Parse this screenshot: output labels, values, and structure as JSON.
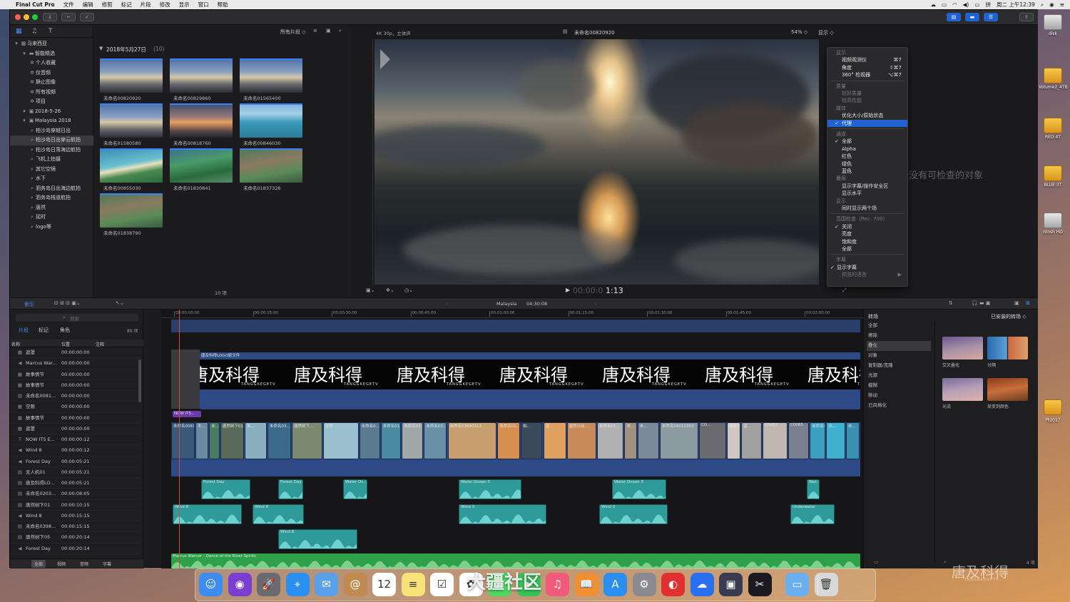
{
  "menubar": {
    "app": "Final Cut Pro",
    "items": [
      "文件",
      "编辑",
      "修剪",
      "标记",
      "片段",
      "修改",
      "显示",
      "窗口",
      "帮助"
    ],
    "clock": "周二 上午12:39"
  },
  "library": {
    "items": [
      {
        "label": "马来西亚",
        "indent": 0,
        "icon": "library-icon"
      },
      {
        "label": "智能精选",
        "indent": 1,
        "icon": "folder-icon"
      },
      {
        "label": "个人收藏",
        "indent": 2,
        "icon": "gear-icon"
      },
      {
        "label": "仅音频",
        "indent": 2,
        "icon": "gear-icon"
      },
      {
        "label": "静止图像",
        "indent": 2,
        "icon": "gear-icon"
      },
      {
        "label": "所有视频",
        "indent": 2,
        "icon": "gear-icon"
      },
      {
        "label": "项目",
        "indent": 2,
        "icon": "gear-icon"
      },
      {
        "label": "2018-5-26",
        "indent": 1,
        "icon": "event-icon"
      },
      {
        "label": "Malaysia 2018",
        "indent": 1,
        "icon": "event-icon"
      },
      {
        "label": "柏沙岛穿越日出",
        "indent": 2,
        "icon": "keyword-icon"
      },
      {
        "label": "柏沙岛日出穿云航拍",
        "indent": 2,
        "icon": "keyword-icon",
        "selected": true
      },
      {
        "label": "柏沙岛日落海边航拍",
        "indent": 2,
        "icon": "keyword-icon"
      },
      {
        "label": "飞机上拍摄",
        "indent": 2,
        "icon": "keyword-icon"
      },
      {
        "label": "其它空镜",
        "indent": 2,
        "icon": "keyword-icon"
      },
      {
        "label": "水下",
        "indent": 2,
        "icon": "keyword-icon"
      },
      {
        "label": "泗务岛日出海边航拍",
        "indent": 2,
        "icon": "keyword-icon"
      },
      {
        "label": "泗务岛栈道航拍",
        "indent": 2,
        "icon": "keyword-icon"
      },
      {
        "label": "唐然",
        "indent": 2,
        "icon": "keyword-icon"
      },
      {
        "label": "延时",
        "indent": 2,
        "icon": "keyword-icon"
      },
      {
        "label": "logo等",
        "indent": 2,
        "icon": "keyword-icon"
      }
    ]
  },
  "browser": {
    "filter": "所有片段 ◇",
    "group_title": "2018年5月27日",
    "group_count": "(10)",
    "count_label": "10 项",
    "clips": [
      {
        "name": "未命名00820920",
        "tone": "sky"
      },
      {
        "name": "未命名00829860",
        "tone": "sky"
      },
      {
        "name": "未命名01565400",
        "tone": "sky"
      },
      {
        "name": "未命名01580580",
        "tone": "sky"
      },
      {
        "name": "未命名00818760",
        "tone": "sunset"
      },
      {
        "name": "未命名00846030",
        "tone": "sea"
      },
      {
        "name": "未命名00855030",
        "tone": "beach"
      },
      {
        "name": "未命名01830841",
        "tone": "island"
      },
      {
        "name": "未命名01837326",
        "tone": "village"
      },
      {
        "name": "未命名01838790",
        "tone": "village"
      }
    ]
  },
  "viewer": {
    "format": "4K 30p，立体声",
    "clip_name": "未命名00820920",
    "zoom": "54% ◇",
    "display": "显示 ◇",
    "timecode_dim": "00:00:0",
    "timecode": "1:13",
    "no_inspect": "没有可检查的对象"
  },
  "display_menu": {
    "rows": [
      {
        "type": "hdr",
        "label": "显示"
      },
      {
        "type": "item",
        "label": "视频观测仪",
        "shortcut": "⌘7"
      },
      {
        "type": "item",
        "label": "角度",
        "shortcut": "⇧⌘7"
      },
      {
        "type": "item",
        "label": "360° 检视器",
        "shortcut": "⌥⌘7"
      },
      {
        "type": "sep"
      },
      {
        "type": "hdr",
        "label": "质量"
      },
      {
        "type": "dis",
        "label": "较好质量"
      },
      {
        "type": "dis",
        "label": "较高性能"
      },
      {
        "type": "hdr",
        "label": "媒体"
      },
      {
        "type": "item",
        "label": "优化大小/原始状态"
      },
      {
        "type": "sel",
        "label": "代理",
        "check": "✓"
      },
      {
        "type": "sep"
      },
      {
        "type": "hdr",
        "label": "通道"
      },
      {
        "type": "item",
        "label": "全部",
        "check": "✓"
      },
      {
        "type": "item",
        "label": "Alpha"
      },
      {
        "type": "item",
        "label": "红色"
      },
      {
        "type": "item",
        "label": "绿色"
      },
      {
        "type": "item",
        "label": "蓝色"
      },
      {
        "type": "hdr",
        "label": "叠层"
      },
      {
        "type": "item",
        "label": "显示字幕/操作安全区"
      },
      {
        "type": "item",
        "label": "显示水平"
      },
      {
        "type": "hdr",
        "label": "显示"
      },
      {
        "type": "item",
        "label": "同时显示两个场"
      },
      {
        "type": "sep"
      },
      {
        "type": "hdr",
        "label": "范围检查（Rec. 709）"
      },
      {
        "type": "item",
        "label": "关闭",
        "check": "✓"
      },
      {
        "type": "item",
        "label": "亮度"
      },
      {
        "type": "item",
        "label": "饱和度"
      },
      {
        "type": "item",
        "label": "全部"
      },
      {
        "type": "sep"
      },
      {
        "type": "hdr",
        "label": "字幕"
      },
      {
        "type": "item",
        "label": "显示字幕",
        "check": "✓",
        "tight": true
      },
      {
        "type": "dis",
        "label": "预览的语言",
        "arrow": "▶"
      }
    ]
  },
  "midbar": {
    "index": "索引",
    "project": "Malaysia",
    "duration": "04:30:08"
  },
  "timeline_index": {
    "search_placeholder": "搜索",
    "tabs": [
      "片段",
      "标记",
      "角色"
    ],
    "count": "89 项",
    "columns": [
      "名称",
      "位置",
      "注释"
    ],
    "rows": [
      {
        "icon": "▦",
        "name": "遮罩",
        "time": "00:00:00:00"
      },
      {
        "icon": "◀",
        "name": "Marcus War...",
        "time": "00:00:00:00"
      },
      {
        "icon": "▦",
        "name": "故事情节",
        "time": "00:00:00:00"
      },
      {
        "icon": "▦",
        "name": "故事情节",
        "time": "00:00:00:00"
      },
      {
        "icon": "▤",
        "name": "未命名0081...",
        "time": "00:00:00:00"
      },
      {
        "icon": "▦",
        "name": "空隙",
        "time": "00:00:00:00"
      },
      {
        "icon": "▦",
        "name": "故事情节",
        "time": "00:00:00:00"
      },
      {
        "icon": "▦",
        "name": "遮罩",
        "time": "00:00:00:00"
      },
      {
        "icon": "T",
        "name": "NOW ITS E...",
        "time": "00:00:00:12"
      },
      {
        "icon": "◀",
        "name": "Wind 8",
        "time": "00:00:00:12"
      },
      {
        "icon": "◀",
        "name": "Forest Day",
        "time": "00:00:05:21"
      },
      {
        "icon": "▤",
        "name": "无人机01",
        "time": "00:00:05:21"
      },
      {
        "icon": "▤",
        "name": "唐及科得LO...",
        "time": "00:00:05:21"
      },
      {
        "icon": "▤",
        "name": "未命名0203...",
        "time": "00:00:08:05"
      },
      {
        "icon": "▤",
        "name": "唐然树下01",
        "time": "00:00:10:15"
      },
      {
        "icon": "◀",
        "name": "Wind 8",
        "time": "00:00:15:15"
      },
      {
        "icon": "▤",
        "name": "未命名0398...",
        "time": "00:00:15:15"
      },
      {
        "icon": "▤",
        "name": "唐然树下05",
        "time": "00:00:20:14"
      },
      {
        "icon": "◀",
        "name": "Forest Day",
        "time": "00:00:20:14"
      }
    ],
    "footer": [
      "全部",
      "视频",
      "音频",
      "字幕"
    ]
  },
  "timeline": {
    "ruler": [
      "00:00:00:00",
      "00:00:15:00",
      "00:00:30:00",
      "00:00:45:00",
      "00:01:00:00",
      "00:01:15:00",
      "00:01:30:00",
      "00:01:45:00",
      "00:02:00:00"
    ],
    "logo_clip": "唐及科得LOGO原文件",
    "logo_text": "唐及科得",
    "logo_sub": "TANG&KEGETV",
    "title_clip": "NOW ITS...",
    "primary_labels": [
      "未命名0081...",
      "木...",
      "未...",
      "唐然树下01",
      "未...",
      "未命名03...",
      "唐然树下...",
      "未命",
      "未命名0...",
      "未命名01...",
      "未命名03...",
      "未命名03...",
      "未命名03990312",
      "未命名01...",
      "柏...",
      "温...",
      "唐然日出...",
      "未命名01...",
      "未...",
      "未...",
      "未命名04012353",
      "CO...",
      "猫咪01",
      "温...",
      "C0052",
      "C0065",
      "未命名0202...",
      "水...",
      "未..."
    ],
    "audio1": [
      "Forest Day",
      "Forest Day",
      "Water Oc...",
      "Water Ocean 3",
      "Water Ocean 3",
      "Wat..."
    ],
    "audio2": [
      "Wind 8",
      "Wind 8",
      "Wind 3",
      "Wind 3",
      "Underwater"
    ],
    "audio3": [
      "Wind 8"
    ],
    "music": "Marcus Warner - Dance of the River Spirits"
  },
  "transitions": {
    "title": "转场",
    "installed": "已安装的转场 ◇",
    "categories": [
      "全部",
      "擦除",
      "叠化",
      "对象",
      "复制器/克隆",
      "光源",
      "模糊",
      "移动",
      "已风格化"
    ],
    "selected_index": 2,
    "items": [
      {
        "name": "交叉叠化",
        "tone": "purple"
      },
      {
        "name": "分隔",
        "tone": "split"
      },
      {
        "name": "光流",
        "tone": "purple2"
      },
      {
        "name": "渐变到颜色",
        "tone": "forest"
      }
    ],
    "count": "4 项"
  },
  "desktop": {
    "icons": [
      "disk",
      "Volume2_4TB",
      "RED 4T",
      "BLUE 3T",
      "ntosh HD",
      "件2017"
    ]
  },
  "dock": {
    "items": [
      {
        "name": "finder-icon",
        "glyph": "☺",
        "color": "#3d8cf0"
      },
      {
        "name": "siri-icon",
        "glyph": "◉",
        "color": "#7a3fd0"
      },
      {
        "name": "launchpad-icon",
        "glyph": "🚀",
        "color": "#6a6a70"
      },
      {
        "name": "safari-icon",
        "glyph": "⌖",
        "color": "#2a8ff0"
      },
      {
        "name": "mail-icon",
        "glyph": "✉",
        "color": "#5aa0e8"
      },
      {
        "name": "contacts-icon",
        "glyph": "@",
        "color": "#c08a50"
      },
      {
        "name": "calendar-icon",
        "glyph": "12",
        "color": "#ffffff"
      },
      {
        "name": "notes-icon",
        "glyph": "≡",
        "color": "#f7e27a"
      },
      {
        "name": "reminders-icon",
        "glyph": "☑",
        "color": "#ffffff"
      },
      {
        "name": "photos-icon",
        "glyph": "✿",
        "color": "#ffffff"
      },
      {
        "name": "messages-icon",
        "glyph": "✉",
        "color": "#4cd964"
      },
      {
        "name": "facetime-icon",
        "glyph": "▶",
        "color": "#3ac25a"
      },
      {
        "name": "music-icon",
        "glyph": "♫",
        "color": "#f25a7a"
      },
      {
        "name": "books-icon",
        "glyph": "📖",
        "color": "#f09030"
      },
      {
        "name": "appstore-icon",
        "glyph": "A",
        "color": "#2a8ff0"
      },
      {
        "name": "preferences-icon",
        "glyph": "⚙",
        "color": "#8a8a90"
      },
      {
        "name": "netease-music-icon",
        "glyph": "◐",
        "color": "#e03030"
      },
      {
        "name": "baidu-netdisk-icon",
        "glyph": "☁",
        "color": "#2a6ff0"
      },
      {
        "name": "motion-icon",
        "glyph": "▣",
        "color": "#3a3a50"
      },
      {
        "name": "final-cut-pro-icon",
        "glyph": "✂",
        "color": "#1a1a20"
      },
      {
        "name": "downloads-folder-icon",
        "glyph": "▭",
        "color": "#6ab0f0"
      },
      {
        "name": "trash-icon",
        "glyph": "🗑",
        "color": "#d8d8d8"
      }
    ]
  },
  "watermark": {
    "brand": "唐及科得",
    "brand_sub": "TANG&KEGETV",
    "dji": "大疆社区"
  },
  "colors": {
    "accent": "#1f62d1",
    "audio": "#2f9a9a",
    "music": "#2ea04a",
    "primary_clip": "#2d4a86"
  }
}
